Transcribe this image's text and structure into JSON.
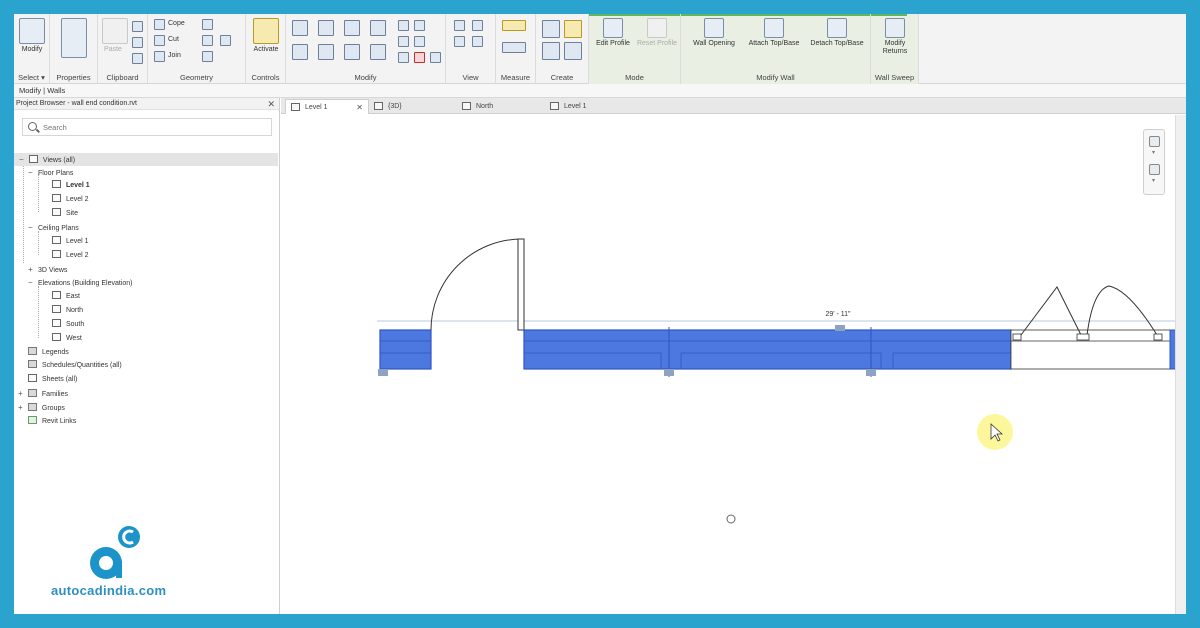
{
  "ribbon": {
    "select_group": {
      "modify_label": "Modify",
      "select_dropdown": "Select ▾"
    },
    "properties_label": "Properties",
    "clipboard": {
      "paste_label": "Paste",
      "panel_label": "Clipboard"
    },
    "geometry": {
      "cope_label": "Cope",
      "cut_label": "Cut",
      "join_label": "Join",
      "panel_label": "Geometry"
    },
    "controls": {
      "activate_label": "Activate",
      "panel_label": "Controls"
    },
    "modify_panel_label": "Modify",
    "view_panel_label": "View",
    "measure_panel_label": "Measure",
    "create_panel_label": "Create",
    "mode": {
      "edit_profile": "Edit Profile",
      "reset_profile": "Reset Profile",
      "panel_label": "Mode"
    },
    "modify_wall": {
      "wall_opening": "Wall Opening",
      "attach_top_base": "Attach Top/Base",
      "detach_top_base": "Detach Top/Base",
      "panel_label": "Modify Wall"
    },
    "wall_sweep": {
      "modify_returns_line1": "Modify",
      "modify_returns_line2": "Returns",
      "panel_label": "Wall Sweep"
    }
  },
  "context_bar": {
    "text": "Modify | Walls"
  },
  "project_browser": {
    "title": "Project Browser - wall end condition.rvt",
    "search_placeholder": "Search",
    "tree": {
      "views": "Views (all)",
      "floor_plans": "Floor Plans",
      "fp_level1": "Level 1",
      "fp_level2": "Level 2",
      "fp_site": "Site",
      "ceiling_plans": "Ceiling Plans",
      "cp_level1": "Level 1",
      "cp_level2": "Level 2",
      "views_3d": "3D Views",
      "elevations": "Elevations (Building Elevation)",
      "el_east": "East",
      "el_north": "North",
      "el_south": "South",
      "el_west": "West",
      "legends": "Legends",
      "schedules": "Schedules/Quantities (all)",
      "sheets": "Sheets (all)",
      "families": "Families",
      "groups": "Groups",
      "revit_links": "Revit Links"
    }
  },
  "tabs": [
    {
      "label": "Level 1",
      "active": true
    },
    {
      "label": "{3D}",
      "active": false
    },
    {
      "label": "North",
      "active": false
    },
    {
      "label": "Level 1",
      "active": false
    }
  ],
  "canvas": {
    "dimension_text": "29' - 11\""
  },
  "logo": {
    "text": "autocadindia.com"
  },
  "colors": {
    "wall_fill": "#4d78e0",
    "wall_dark": "#2f55c4",
    "frame": "#2aa3cf",
    "logo_blue": "#2c8fbf"
  }
}
